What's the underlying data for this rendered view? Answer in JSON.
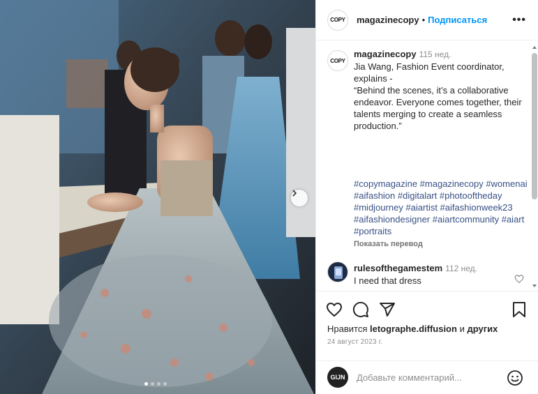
{
  "post": {
    "username": "magazinecopy",
    "separator": "•",
    "follow_label": "Подписаться",
    "more_label": "•••",
    "logo_text": "COPY"
  },
  "caption": {
    "username": "magazinecopy",
    "time": "115 нед.",
    "text": "Jia Wang, Fashion Event coordinator, explains -\n“Behind the scenes, it’s a collaborative endeavor. Everyone comes together, their talents merging to create a seamless production.”",
    "hashtags": "#copymagazine #magazinecopy #womenai #aifashion #digitalart #photooftheday #midjourney #aiartist #aifashionweek23 #aifashiondesigner #aiartcommunity #aiart #portraits",
    "translate_label": "Показать перевод"
  },
  "comments": [
    {
      "username": "rulesofthegamestem",
      "time": "112 нед.",
      "text": "I need that dress"
    }
  ],
  "likes": {
    "prefix": "Нравится",
    "user": "letographe.diffusion",
    "and": "и",
    "others": "других"
  },
  "date": "24 август 2023 г.",
  "add_comment": {
    "avatar_text": "GIJN",
    "placeholder": "Добавьте комментарий..."
  },
  "carousel": {
    "total": 4,
    "active": 0
  },
  "colors": {
    "link": "#0095f6",
    "hashtag": "#385185",
    "text": "#262626",
    "muted": "#8e8e8e"
  },
  "icons": [
    "next-arrow-icon",
    "more-icon",
    "heart-icon",
    "comment-icon",
    "share-icon",
    "bookmark-icon",
    "emoji-icon"
  ]
}
